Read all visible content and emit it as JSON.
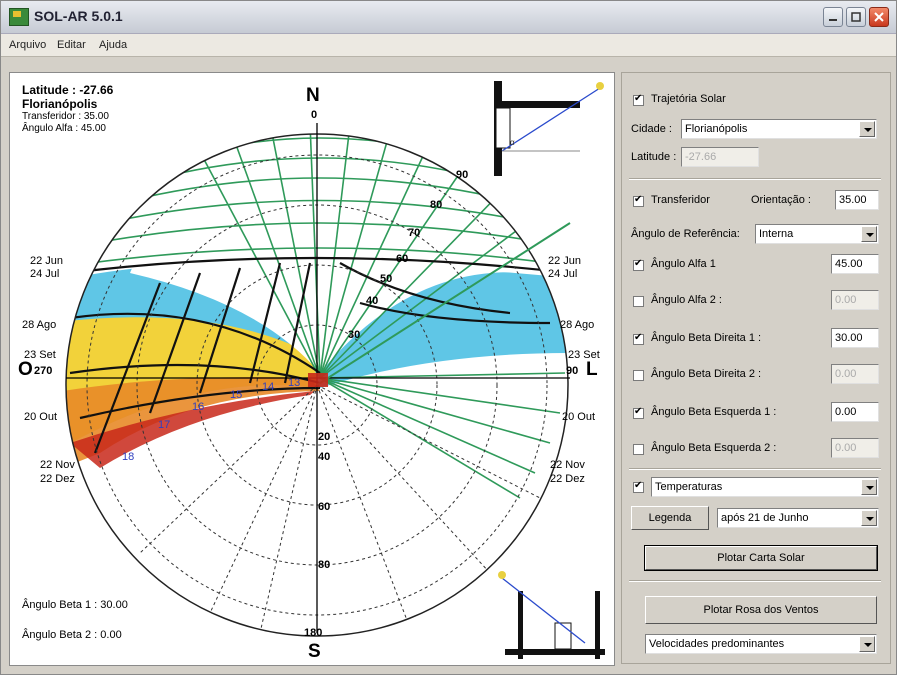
{
  "window": {
    "title": "SOL-AR 5.0.1"
  },
  "menu": [
    {
      "label": "Arquivo"
    },
    {
      "label": "Editar"
    },
    {
      "label": "Ajuda"
    }
  ],
  "plot": {
    "info": {
      "latitude": "Latitude : -27.66",
      "city": "Florianópolis",
      "transferidor": "Transferidor : 35.00",
      "alfa": "Ângulo Alfa : 45.00"
    },
    "compass": {
      "n": "N",
      "n_deg": "0",
      "s": "S",
      "s_deg": "180",
      "o": "O",
      "o_deg": "270",
      "l": "L",
      "l_deg": "90"
    },
    "dates_left": [
      "22 Jun",
      "24 Jul",
      "28 Ago",
      "23 Set",
      "20 Out",
      "22 Nov",
      "22 Dez"
    ],
    "dates_right": [
      "22 Jun",
      "24 Jul",
      "28 Ago",
      "23 Set",
      "20 Out",
      "22 Nov",
      "22 Dez"
    ],
    "arc_labels": [
      "90",
      "80",
      "70",
      "60",
      "50",
      "40",
      "30"
    ],
    "lower_labels": [
      "20",
      "40",
      "60",
      "80"
    ],
    "hours": [
      "18",
      "17",
      "16",
      "15",
      "14",
      "13"
    ],
    "beta1": "Ângulo Beta 1 : 30.00",
    "beta2": "Ângulo Beta 2 : 0.00",
    "colors": {
      "green": "#2f9a5a",
      "blue": "#5fc6e6",
      "yellow": "#f2d23a",
      "orange": "#e88a28",
      "red": "#c8281a"
    }
  },
  "side": {
    "trajetoria": "Trajetória Solar",
    "cidade_label": "Cidade :",
    "cidade_value": "Florianópolis",
    "latitude_label": "Latitude :",
    "latitude_value": "-27.66",
    "transferidor": "Transferidor",
    "orientacao_label": "Orientação :",
    "orientacao_value": "35.00",
    "ref_label": "Ângulo de Referência:",
    "ref_value": "Interna",
    "alfa1": "Ângulo Alfa 1",
    "alfa1_value": "45.00",
    "alfa2": "Ângulo Alfa 2 :",
    "alfa2_value": "0.00",
    "beta_d1": "Ângulo Beta Direita 1 :",
    "beta_d1_value": "30.00",
    "beta_d2": "Ângulo Beta Direita 2 :",
    "beta_d2_value": "0.00",
    "beta_e1": "Ângulo Beta Esquerda 1 :",
    "beta_e1_value": "0.00",
    "beta_e2": "Ângulo Beta Esquerda 2 :",
    "beta_e2_value": "0.00",
    "temperaturas": "Temperaturas",
    "legenda": "Legenda",
    "periodo": "após 21 de Junho",
    "plotar_carta": "Plotar Carta Solar",
    "plotar_rosa": "Plotar Rosa dos Ventos",
    "velocidades": "Velocidades predominantes"
  }
}
